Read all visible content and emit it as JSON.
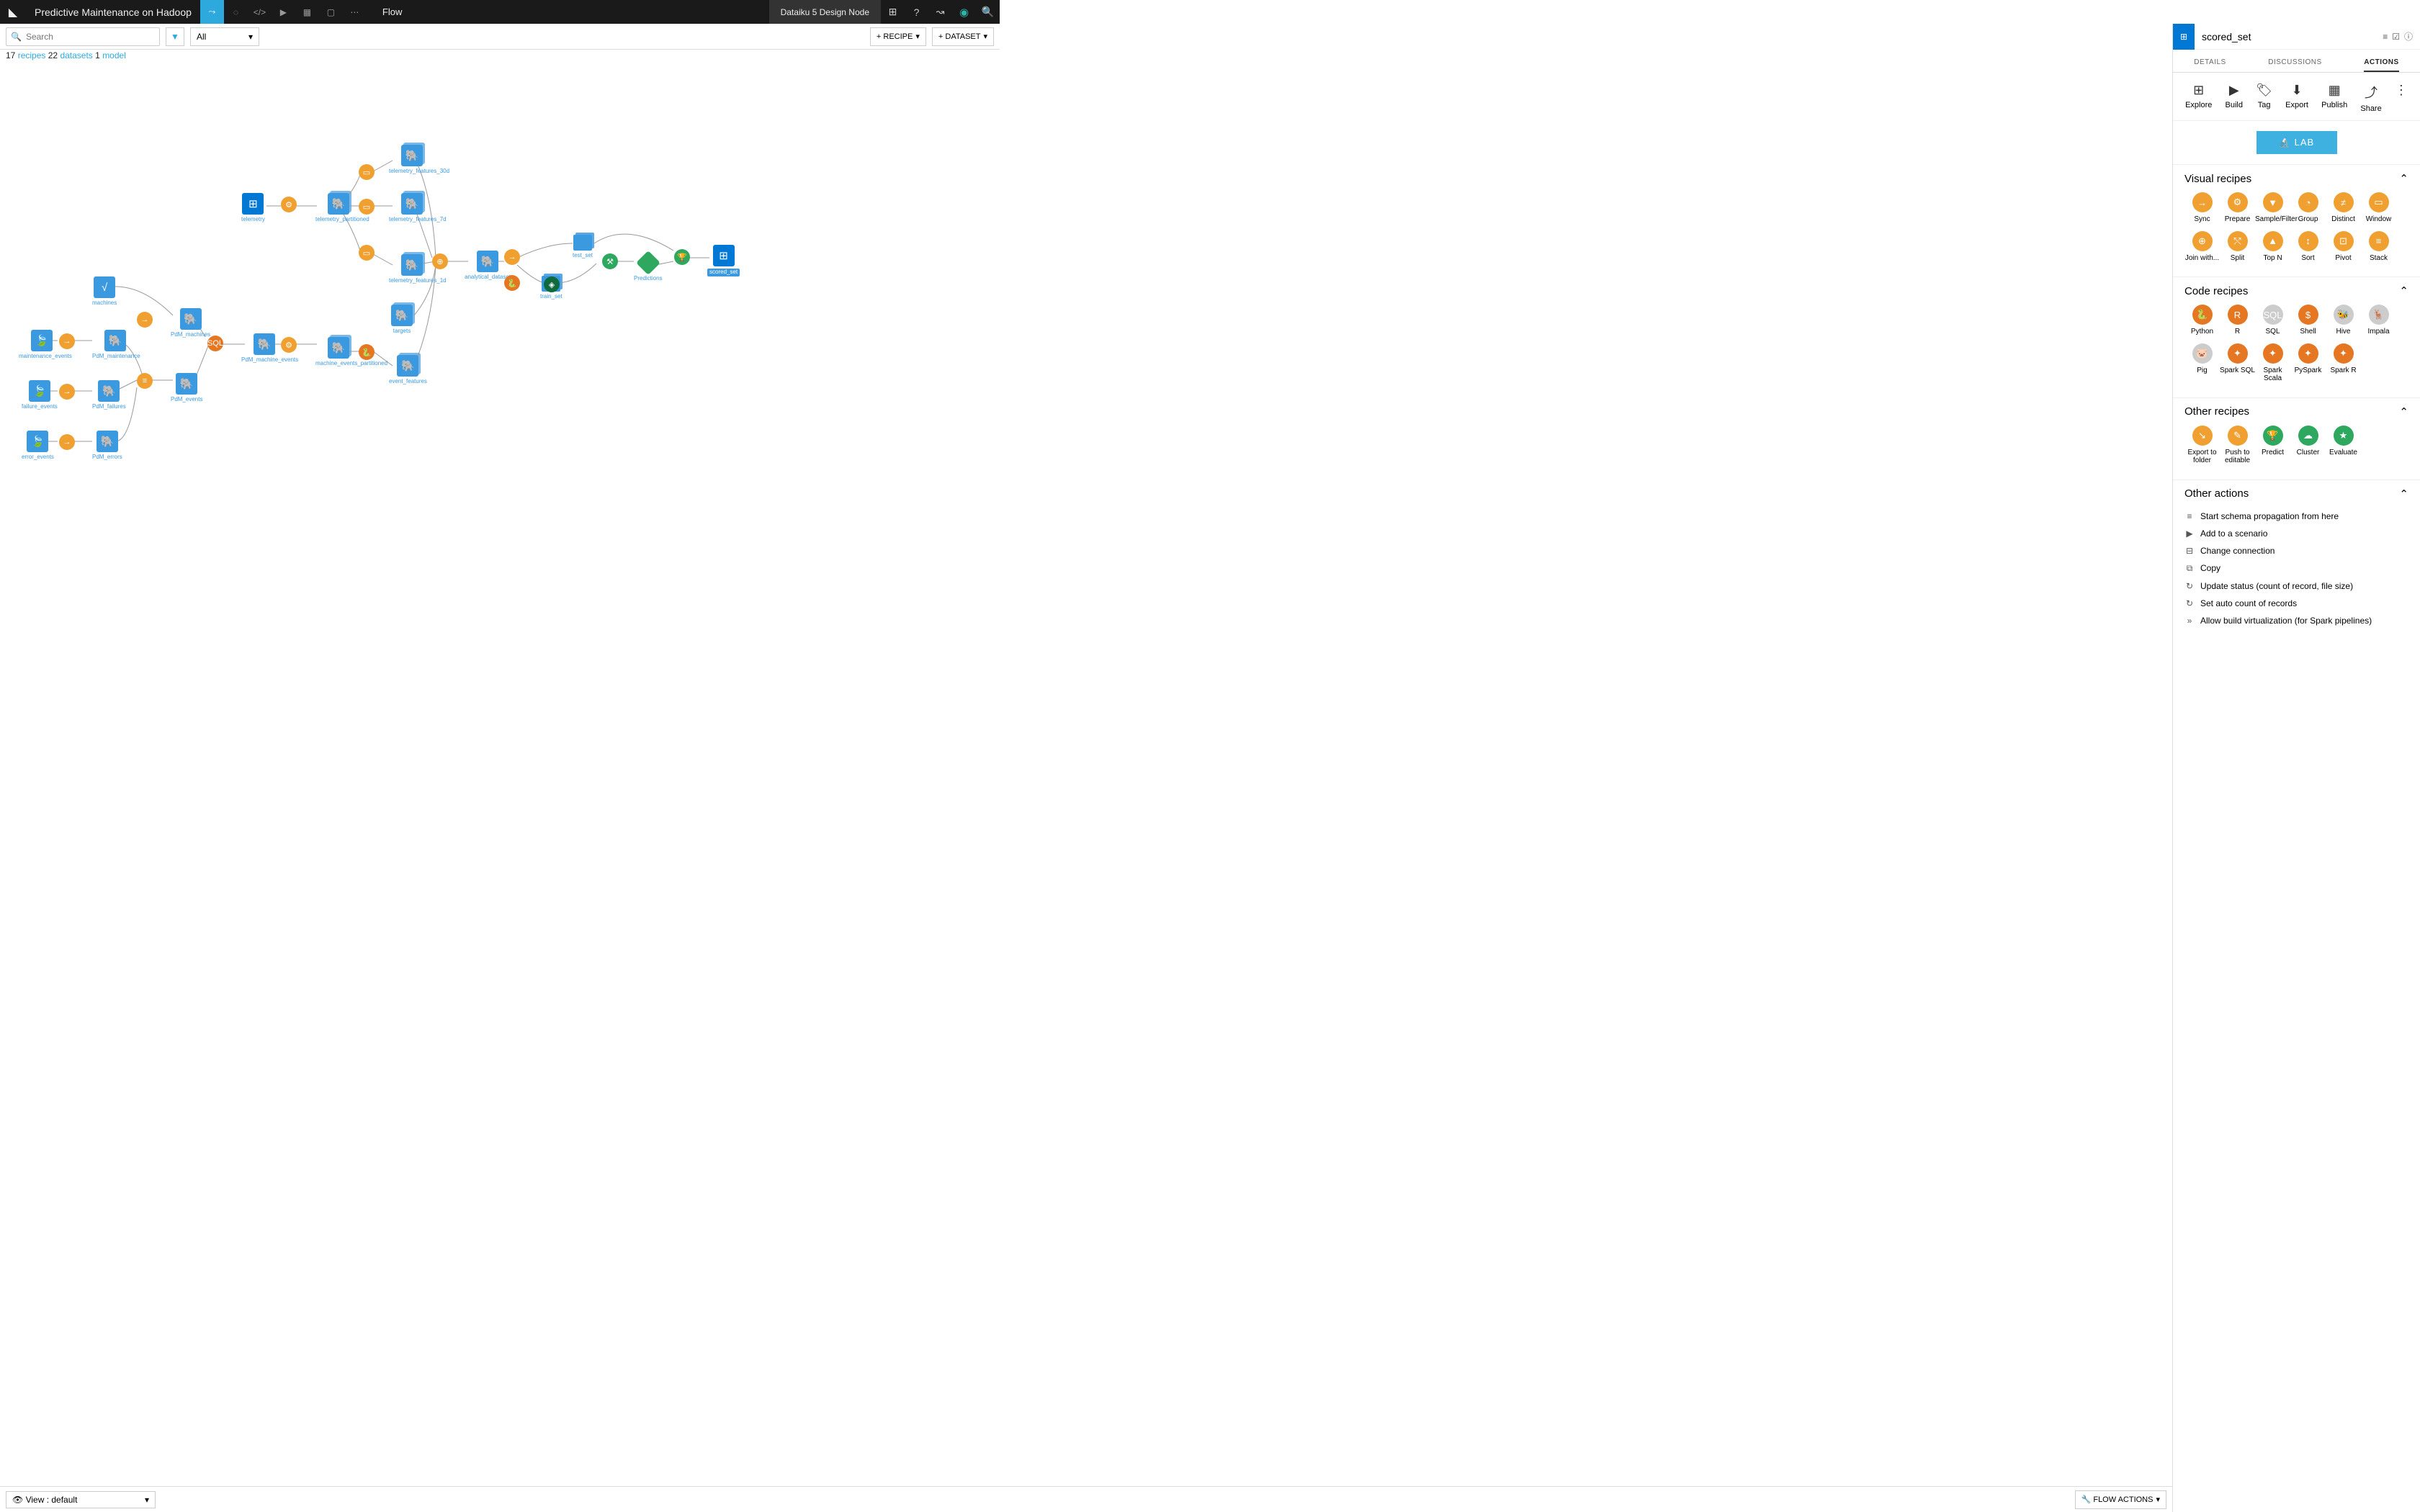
{
  "topbar": {
    "project_name": "Predictive Maintenance on Hadoop",
    "flow_label": "Flow",
    "node_label": "Dataiku 5 Design Node"
  },
  "subbar": {
    "search_placeholder": "Search",
    "filter_label": "All",
    "add_recipe": "+ RECIPE",
    "add_dataset": "+ DATASET"
  },
  "stats": {
    "recipes_n": "17",
    "recipes_w": "recipes",
    "datasets_n": "22",
    "datasets_w": "datasets",
    "models_n": "1",
    "models_w": "model"
  },
  "panel": {
    "dataset_name": "scored_set",
    "tabs": [
      "DETAILS",
      "DISCUSSIONS",
      "ACTIONS"
    ],
    "actions": [
      "Explore",
      "Build",
      "Tag",
      "Export",
      "Publish",
      "Share"
    ],
    "lab": "LAB",
    "visual_h": "Visual recipes",
    "visual": [
      "Sync",
      "Prepare",
      "Sample/Filter",
      "Group",
      "Distinct",
      "Window",
      "Join with...",
      "Split",
      "Top N",
      "Sort",
      "Pivot",
      "Stack"
    ],
    "code_h": "Code recipes",
    "code": [
      "Python",
      "R",
      "SQL",
      "Shell",
      "Hive",
      "Impala",
      "Pig",
      "Spark SQL",
      "Spark Scala",
      "PySpark",
      "Spark R"
    ],
    "other_h": "Other recipes",
    "other": [
      "Export to folder",
      "Push to editable",
      "Predict",
      "Cluster",
      "Evaluate"
    ],
    "oa_h": "Other actions",
    "oa": [
      "Start schema propagation from here",
      "Add to a scenario",
      "Change connection",
      "Copy",
      "Update status (count of record, file size)",
      "Set auto count of records",
      "Allow build virtualization (for Spark pipelines)"
    ]
  },
  "nodes": {
    "telemetry": "telemetry",
    "machines": "machines",
    "maintenance": "maintenance_events",
    "failure": "failure_events",
    "error": "error_events",
    "pdm_machines": "PdM_machines",
    "pdm_maint": "PdM_maintenance",
    "pdm_failures": "PdM_failures",
    "pdm_errors": "PdM_errors",
    "pdm_events": "PdM_events",
    "tel_part": "telemetry_partitioned",
    "tel_30d": "telemetry_features_30d",
    "tel_7d": "telemetry_features_7d",
    "tel_1d": "telemetry_features_1d",
    "mach_ev": "PdM_machine_events",
    "mach_ev_part": "machine_events_partitioned",
    "ev_feat": "event_features",
    "targets": "targets",
    "analytical": "analytical_dataset",
    "test": "test_set",
    "train": "train_set",
    "predictions": "Predictions",
    "scored": "scored_set"
  },
  "botbar": {
    "view": "View : default",
    "flow_actions": "FLOW ACTIONS"
  }
}
